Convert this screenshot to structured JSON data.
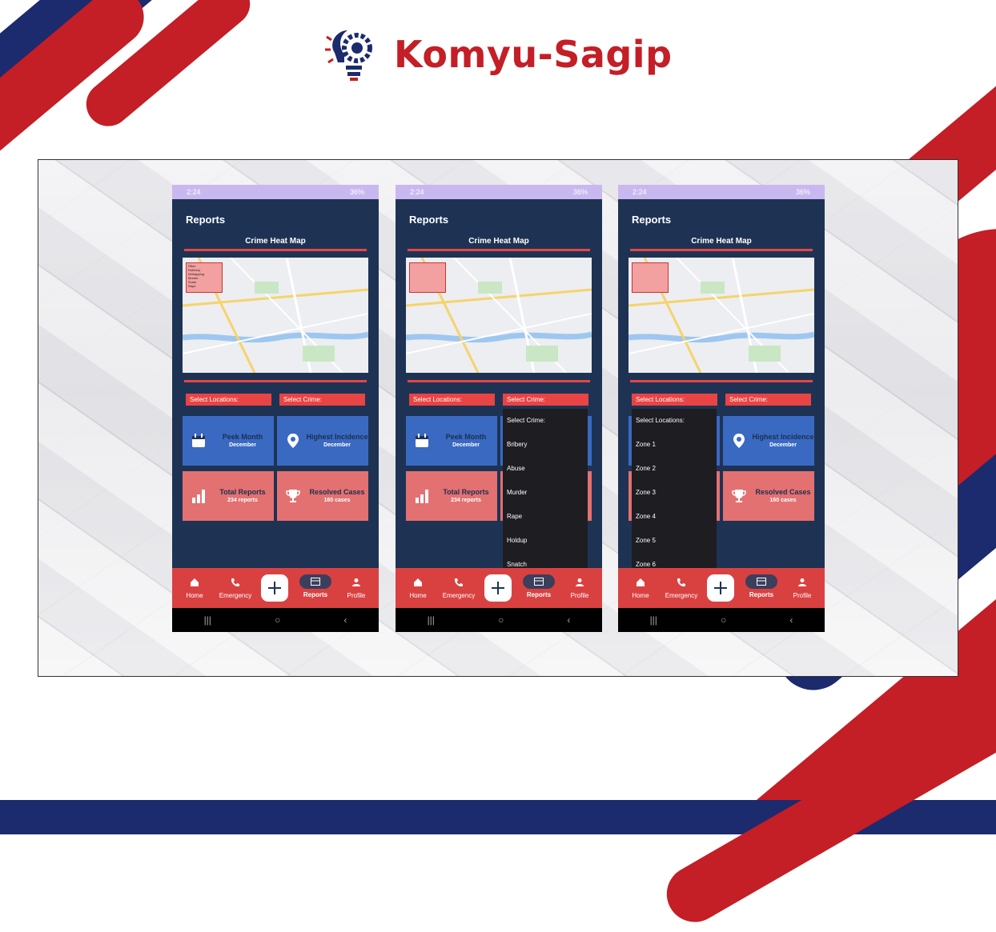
{
  "brand": {
    "name": "Komyu-Sagip"
  },
  "colors": {
    "navy": "#1e3354",
    "red": "#d94141",
    "brand_red": "#c41e26",
    "brand_navy": "#1c2a6e",
    "card_blue": "#3a69c2",
    "card_red": "#e37171"
  },
  "screens": [
    {
      "status_time": "2:24",
      "status_right": "36%",
      "title": "Reports",
      "heatmap_title": "Crime Heat Map",
      "map_filter": {
        "label": "Filter:",
        "options": [
          "Robbery",
          "Kidnapping",
          "Murder",
          "Scam",
          "Rape"
        ]
      },
      "select_locations": "Select Locations:",
      "select_crime": "Select Crime:",
      "cards": [
        {
          "title": "Peek Month",
          "sub": "December",
          "icon": "calendar-icon"
        },
        {
          "title": "Highest Incidence",
          "sub": "December",
          "icon": "location-pin-icon"
        },
        {
          "title": "Total Reports",
          "sub": "234 reports",
          "icon": "bar-chart-icon"
        },
        {
          "title": "Resolved Cases",
          "sub": "160 cases",
          "icon": "trophy-icon"
        }
      ],
      "nav": [
        "Home",
        "Emergency",
        "Reports",
        "Profile"
      ]
    },
    {
      "status_time": "2:24",
      "status_right": "36%",
      "title": "Reports",
      "heatmap_title": "Crime Heat Map",
      "select_locations": "Select Locations:",
      "select_crime": "Select Crime:",
      "cards": [
        {
          "title": "Peek Month",
          "sub": "December"
        },
        {
          "title": "Total Reports",
          "sub": "234 reports"
        }
      ],
      "dropdown": [
        "Select Crime:",
        "Bribery",
        "Abuse",
        "Murder",
        "Rape",
        "Holdup",
        "Snatch"
      ],
      "nav": [
        "Home",
        "Emergency",
        "Reports",
        "Profile"
      ]
    },
    {
      "status_time": "2:24",
      "status_right": "36%",
      "title": "Reports",
      "heatmap_title": "Crime Heat Map",
      "select_locations": "Select Locations:",
      "select_crime": "Select Crime:",
      "cards": [
        {
          "title": "Highest Incidence",
          "sub": "December"
        },
        {
          "title": "Resolved Cases",
          "sub": "160 cases"
        }
      ],
      "dropdown": [
        "Select Locations:",
        "Zone 1",
        "Zone 2",
        "Zone 3",
        "Zone 4",
        "Zone 5",
        "Zone 6"
      ],
      "nav": [
        "Home",
        "Emergency",
        "Reports",
        "Profile"
      ]
    }
  ]
}
